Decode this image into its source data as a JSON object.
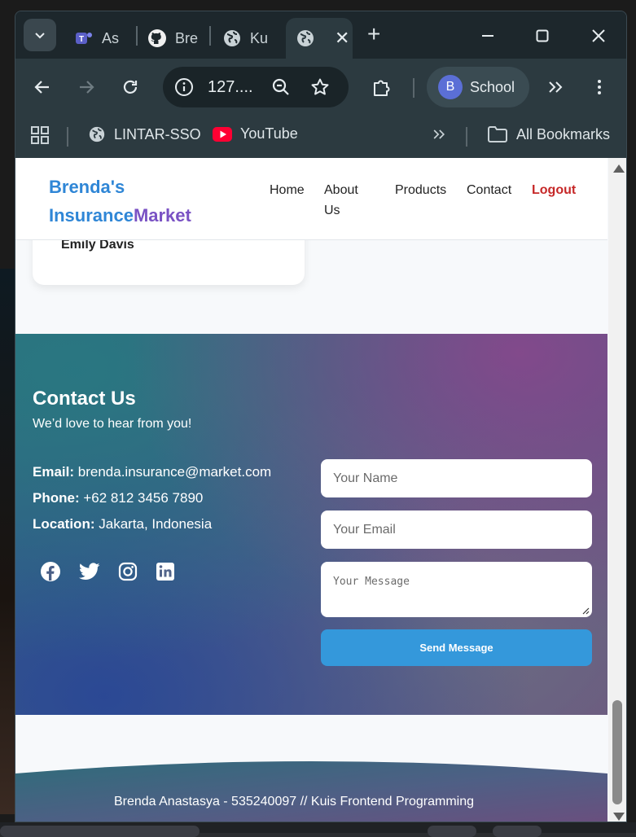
{
  "browser": {
    "tabs": [
      {
        "label": "As",
        "icon": "teams-icon"
      },
      {
        "label": "Bre",
        "icon": "github-icon"
      },
      {
        "label": "Ku",
        "icon": "globe-icon"
      },
      {
        "label": "",
        "icon": "globe-icon",
        "active": true
      }
    ],
    "address": "127....",
    "profile": {
      "initial": "B",
      "label": "School"
    },
    "bookmarks": [
      {
        "label": "LINTAR-SSO",
        "icon": "globe-icon"
      },
      {
        "label": "YouTube",
        "icon": "youtube-icon"
      }
    ],
    "all_bookmarks": "All Bookmarks"
  },
  "page": {
    "brand": {
      "part1": "Brenda's",
      "part2": "Insurance",
      "part3": "Market"
    },
    "nav": {
      "home": "Home",
      "about": "About Us",
      "products": "Products",
      "contact": "Contact",
      "logout": "Logout"
    },
    "testimonial_name": "Emily Davis",
    "contact": {
      "title": "Contact Us",
      "subtitle": "We’d love to hear from you!",
      "email_label": "Email:",
      "email_value": "brenda.insurance@market.com",
      "phone_label": "Phone:",
      "phone_value": "+62 812 3456 7890",
      "location_label": "Location:",
      "location_value": "Jakarta, Indonesia",
      "form": {
        "name_placeholder": "Your Name",
        "email_placeholder": "Your Email",
        "message_placeholder": "Your Message",
        "send_label": "Send Message"
      }
    },
    "footer": "Brenda Anastasya - 535240097 // Kuis Frontend Programming"
  },
  "colors": {
    "brand_blue": "#2f86d6",
    "brand_purple": "#7a52c4",
    "logout_red": "#c62828",
    "button_blue": "#3498db"
  }
}
